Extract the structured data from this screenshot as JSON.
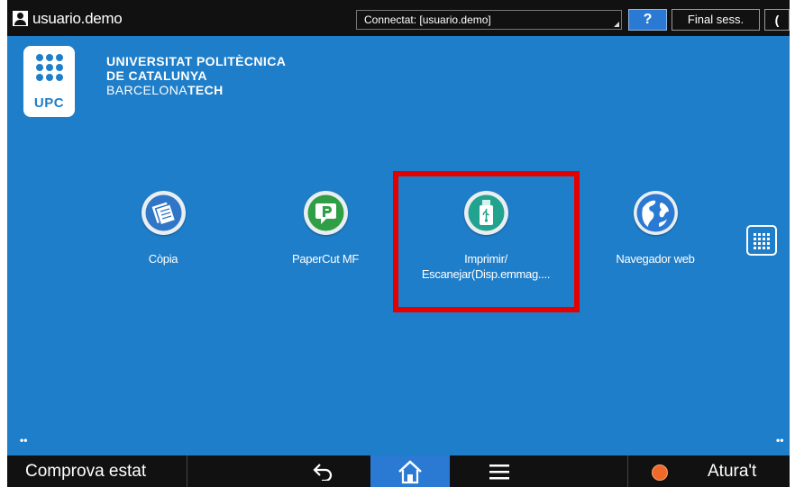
{
  "topbar": {
    "username": "usuario.demo",
    "connected": "Connectat: [usuario.demo]",
    "help_label": "?",
    "logout_label": "Final sess.",
    "moon_label": "("
  },
  "header": {
    "logo_text": "UPC",
    "line1": "UNIVERSITAT POLITÈCNICA",
    "line2": "DE CATALUNYA",
    "line3_a": "BARCELONA",
    "line3_b": "TECH"
  },
  "apps": [
    {
      "label": "Còpia",
      "icon": "copy-icon"
    },
    {
      "label": "PaperCut MF",
      "icon": "papercut-icon"
    },
    {
      "label_line1": "Imprimir/",
      "label_line2": "Escanejar(Disp.emmag....",
      "icon": "usb-storage-icon",
      "highlighted": true
    },
    {
      "label": "Navegador web",
      "icon": "globe-icon"
    }
  ],
  "page_indicator": "••",
  "bottombar": {
    "status_label": "Comprova estat",
    "back_icon": "back-arrow-icon",
    "home_icon": "home-icon",
    "menu_icon": "menu-icon",
    "stop_label": "Atura't"
  },
  "colors": {
    "background": "#1f7ec9",
    "highlight": "#e50000",
    "bar": "#111111",
    "home_active": "#2a7ad4"
  }
}
